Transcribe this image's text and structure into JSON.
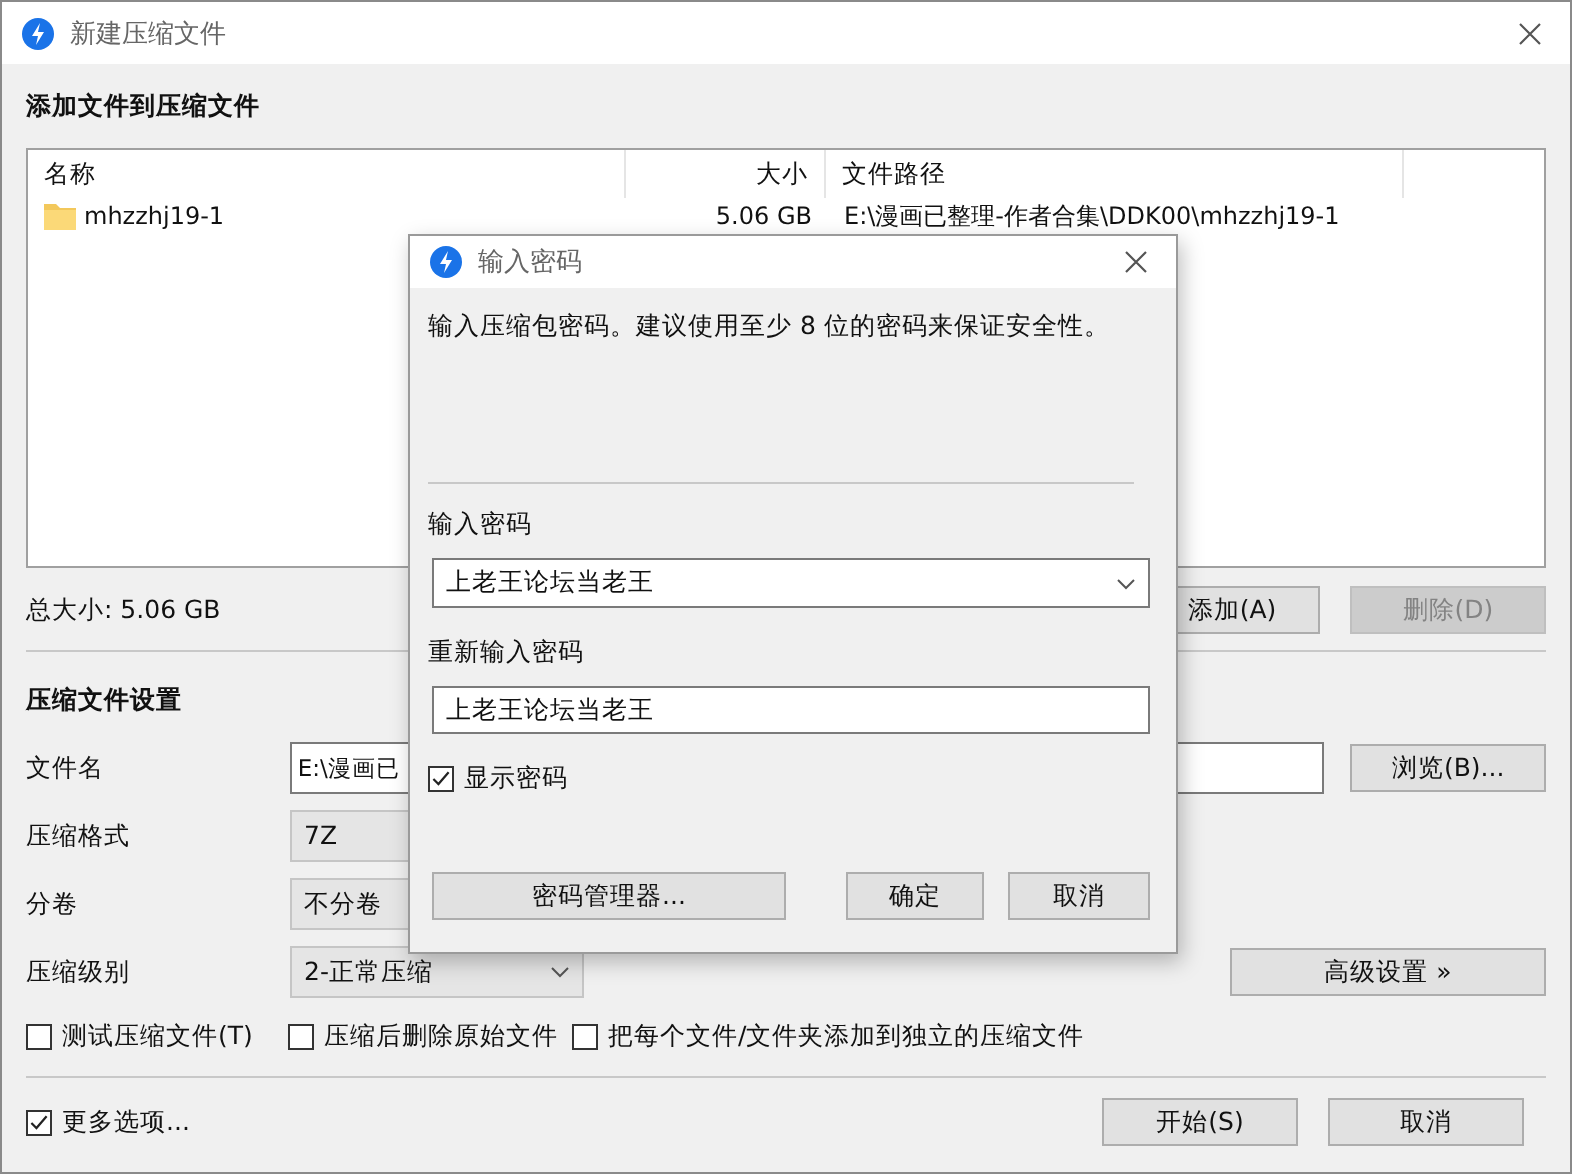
{
  "window": {
    "title": "新建压缩文件"
  },
  "files_section": {
    "heading": "添加文件到压缩文件",
    "columns": [
      "名称",
      "大小",
      "文件路径"
    ],
    "rows": [
      {
        "name": "mhzzhj19-1",
        "size": "5.06 GB",
        "path": "E:\\漫画已整理-作者合集\\DDK00\\mhzzhj19-1"
      }
    ],
    "total": "总大小: 5.06 GB",
    "buttons": [
      {
        "label": "添加(A)",
        "disabled": false
      },
      {
        "label": "删除(D)",
        "disabled": true
      }
    ]
  },
  "settings": {
    "heading": "压缩文件设置",
    "fields": [
      {
        "kind": "text",
        "label": "文件名",
        "value": "E:\\漫画已"
      },
      {
        "kind": "select",
        "label": "压缩格式",
        "value": "7Z"
      },
      {
        "kind": "select",
        "label": "分卷",
        "value": "不分卷"
      },
      {
        "kind": "dropdown",
        "label": "压缩级别",
        "value": "2-正常压缩"
      }
    ],
    "browse_button": "浏览(B)...",
    "advanced_button": "高级设置 »",
    "options": [
      {
        "label": "测试压缩文件(T)",
        "checked": false
      },
      {
        "label": "压缩后删除原始文件",
        "checked": false
      },
      {
        "label": "把每个文件/文件夹添加到独立的压缩文件",
        "checked": false
      }
    ]
  },
  "footer": {
    "more_options": {
      "label": "更多选项...",
      "checked": true
    },
    "buttons": [
      "开始(S)",
      "取消"
    ]
  },
  "password_dialog": {
    "title": "输入密码",
    "message": "输入压缩包密码。建议使用至少 8 位的密码来保证安全性。",
    "password_label": "输入密码",
    "password": "上老王论坛当老王",
    "confirm_label": "重新输入密码",
    "confirm": "上老王论坛当老王",
    "show_password": {
      "label": "显示密码",
      "checked": true
    },
    "manager_button": "密码管理器...",
    "buttons": [
      "确定",
      "取消"
    ]
  }
}
